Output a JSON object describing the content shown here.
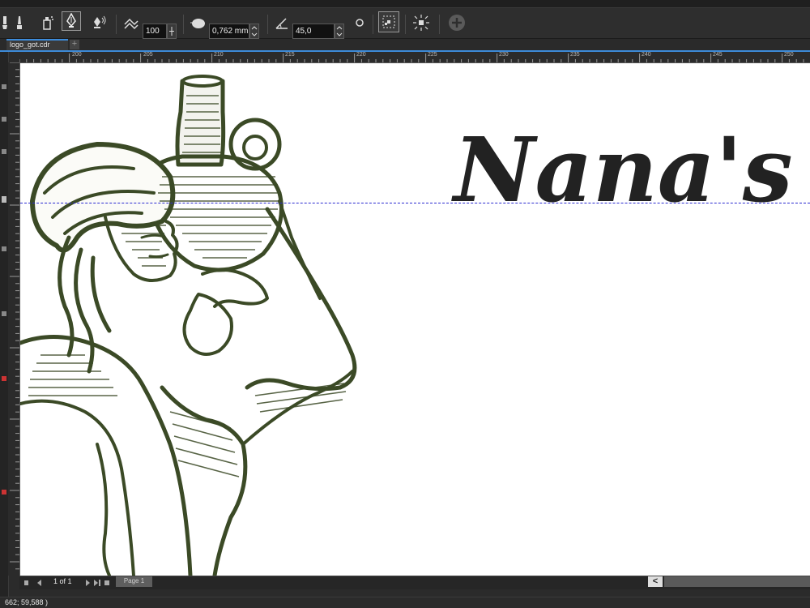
{
  "toolbar": {
    "smoothing_value": "100",
    "width_value": "0,762 mm",
    "angle_value": "45,0"
  },
  "document": {
    "tab_name": "logo_got.cdr",
    "add_tab_label": "+"
  },
  "ruler": {
    "h_ticks": [
      "200",
      "205",
      "210",
      "215",
      "220",
      "225",
      "230",
      "235",
      "240",
      "245",
      "250"
    ]
  },
  "canvas": {
    "heading_text": "Nana's",
    "heading_color": "#222222",
    "illustration_color": "#3b4a26",
    "guide_color": "#2a2ad0"
  },
  "pagenav": {
    "page_count": "1 of 1",
    "page_tab": "Page 1",
    "scroll_left_label": "<"
  },
  "status": {
    "coords": "662; 59,588 )"
  },
  "icons": [
    "brush-icon",
    "sprayer-icon",
    "pen-nib-icon",
    "calligraphic-icon",
    "smoothing-icon",
    "width-nib-icon",
    "angle-icon",
    "circle-icon",
    "frame-icon",
    "scatter-icon",
    "add-icon"
  ]
}
